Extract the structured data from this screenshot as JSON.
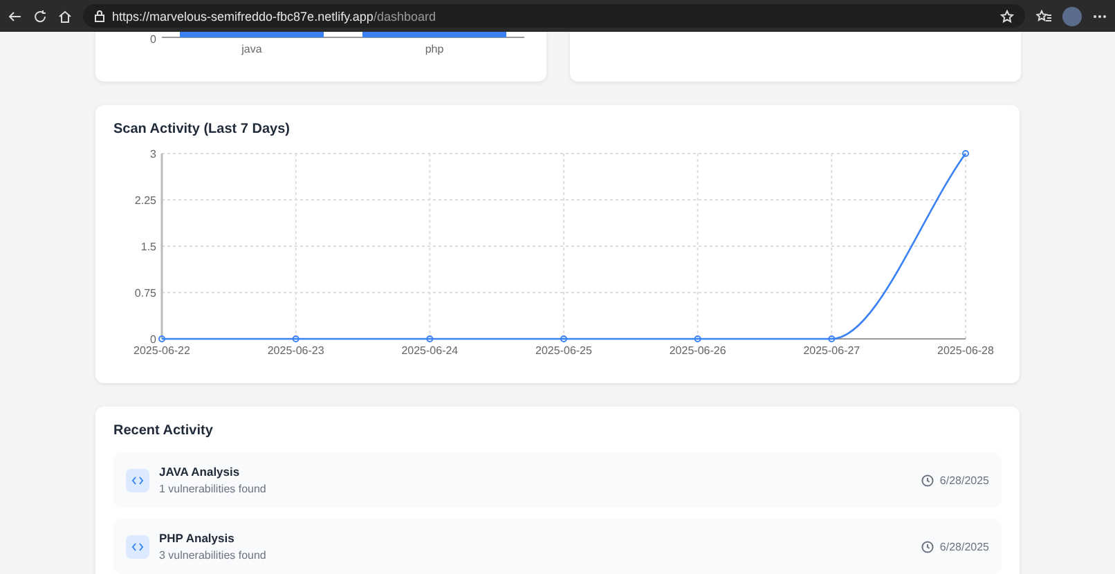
{
  "browser": {
    "url_host": "https://marvelous-semifreddo-fbc87e.netlify.app",
    "url_path": "/dashboard"
  },
  "top_chart": {
    "y_tick": "0",
    "categories": [
      "java",
      "php"
    ]
  },
  "scan_activity": {
    "title": "Scan Activity (Last 7 Days)",
    "chart_data": {
      "type": "line",
      "x": [
        "2025-06-22",
        "2025-06-23",
        "2025-06-24",
        "2025-06-25",
        "2025-06-26",
        "2025-06-27",
        "2025-06-28"
      ],
      "grid": true,
      "series": [
        {
          "color": "#3b82f6",
          "marker": "circle",
          "values": [
            0,
            0,
            0,
            0,
            0,
            0,
            3
          ]
        }
      ],
      "ylim": [
        0,
        3
      ],
      "yticks": [
        0,
        {
          "value": 0.75,
          "label": "0.75"
        },
        {
          "value": 1.5,
          "label": "1.5"
        },
        {
          "value": 2.25,
          "label": "2.25"
        },
        3
      ]
    }
  },
  "recent_activity": {
    "title": "Recent Activity",
    "items": [
      {
        "title": "JAVA Analysis",
        "subtitle": "1 vulnerabilities found",
        "date": "6/28/2025"
      },
      {
        "title": "PHP Analysis",
        "subtitle": "3 vulnerabilities found",
        "date": "6/28/2025"
      }
    ]
  }
}
